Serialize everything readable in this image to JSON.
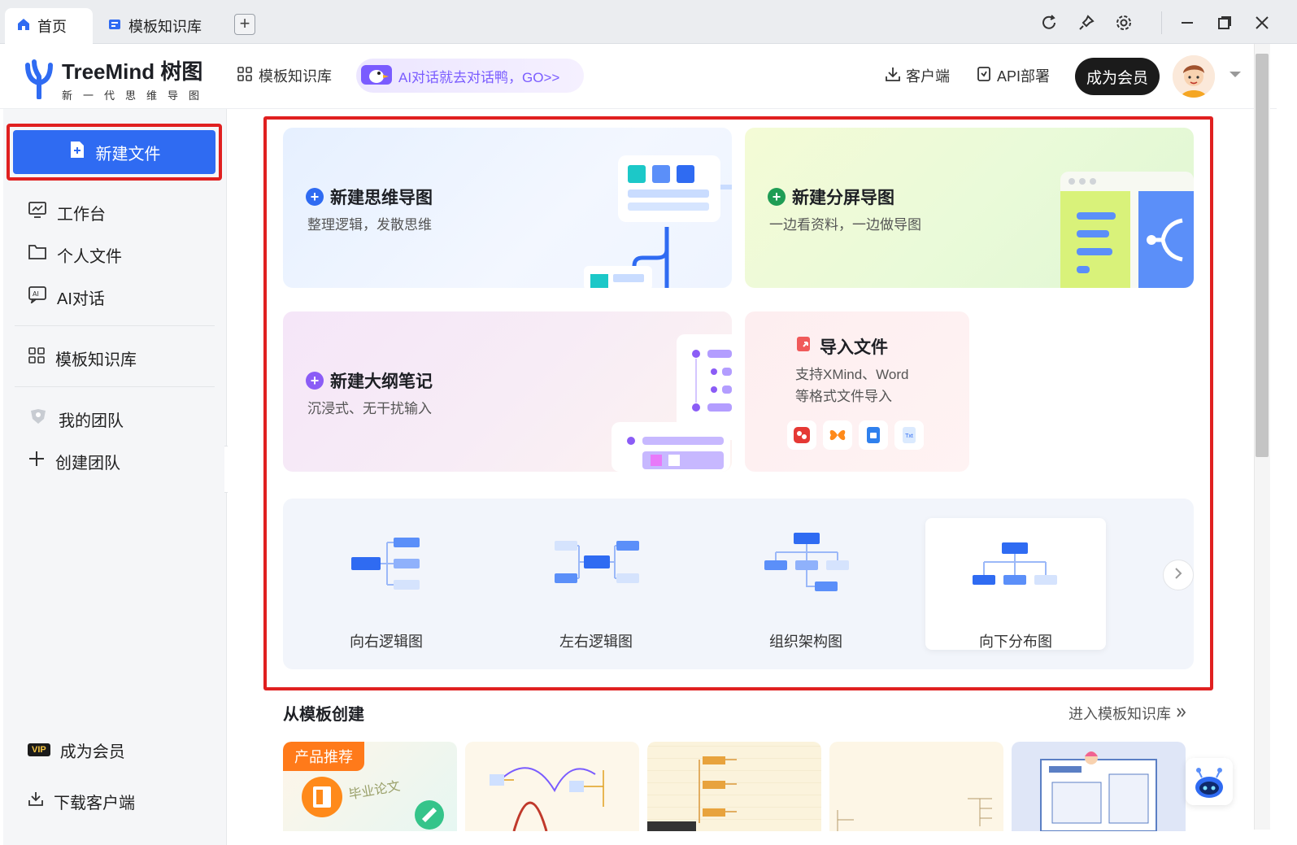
{
  "tabs": {
    "home": "首页",
    "library": "模板知识库",
    "add": "+"
  },
  "header": {
    "logo_name": "TreeMind 树图",
    "logo_sub": "新一代思维导图",
    "nav_library": "模板知识库",
    "ai_banner": "AI对话就去对话鸭，GO>>",
    "client": "客户端",
    "api": "API部署",
    "become_vip": "成为会员"
  },
  "sidebar": {
    "new_file": "新建文件",
    "items": [
      {
        "label": "工作台",
        "icon": "monitor-icon"
      },
      {
        "label": "个人文件",
        "icon": "folder-icon"
      },
      {
        "label": "AI对话",
        "icon": "ai-chat-icon"
      },
      {
        "label": "模板知识库",
        "icon": "grid-icon"
      },
      {
        "label": "我的团队",
        "icon": "team-icon"
      },
      {
        "label": "创建团队",
        "icon": "plus-icon"
      }
    ],
    "vip": "成为会员",
    "vip_badge": "VIP",
    "download": "下载客户端"
  },
  "cards": {
    "mindmap": {
      "title": "新建思维导图",
      "sub": "整理逻辑，发散思维",
      "accent": "#2f6bf2"
    },
    "split": {
      "title": "新建分屏导图",
      "sub": "一边看资料，一边做导图",
      "accent": "#1f9d55"
    },
    "outline": {
      "title": "新建大纲笔记",
      "sub": "沉浸式、无干扰输入",
      "accent": "#8b5cf6"
    },
    "import": {
      "title": "导入文件",
      "sub_line1": "支持XMind、Word",
      "sub_line2": "等格式文件导入",
      "file_icon_label": "Txt"
    }
  },
  "templates": [
    {
      "label": "向右逻辑图"
    },
    {
      "label": "左右逻辑图"
    },
    {
      "label": "组织架构图"
    },
    {
      "label": "向下分布图"
    }
  ],
  "section": {
    "title": "从模板创建",
    "enter_lib": "进入模板知识库",
    "recommend_badge": "产品推荐",
    "thumb1_text": "毕业论文"
  },
  "colors": {
    "primary": "#2f6bf2",
    "highlight": "#e02020",
    "vip_dark": "#1b1b1b"
  }
}
